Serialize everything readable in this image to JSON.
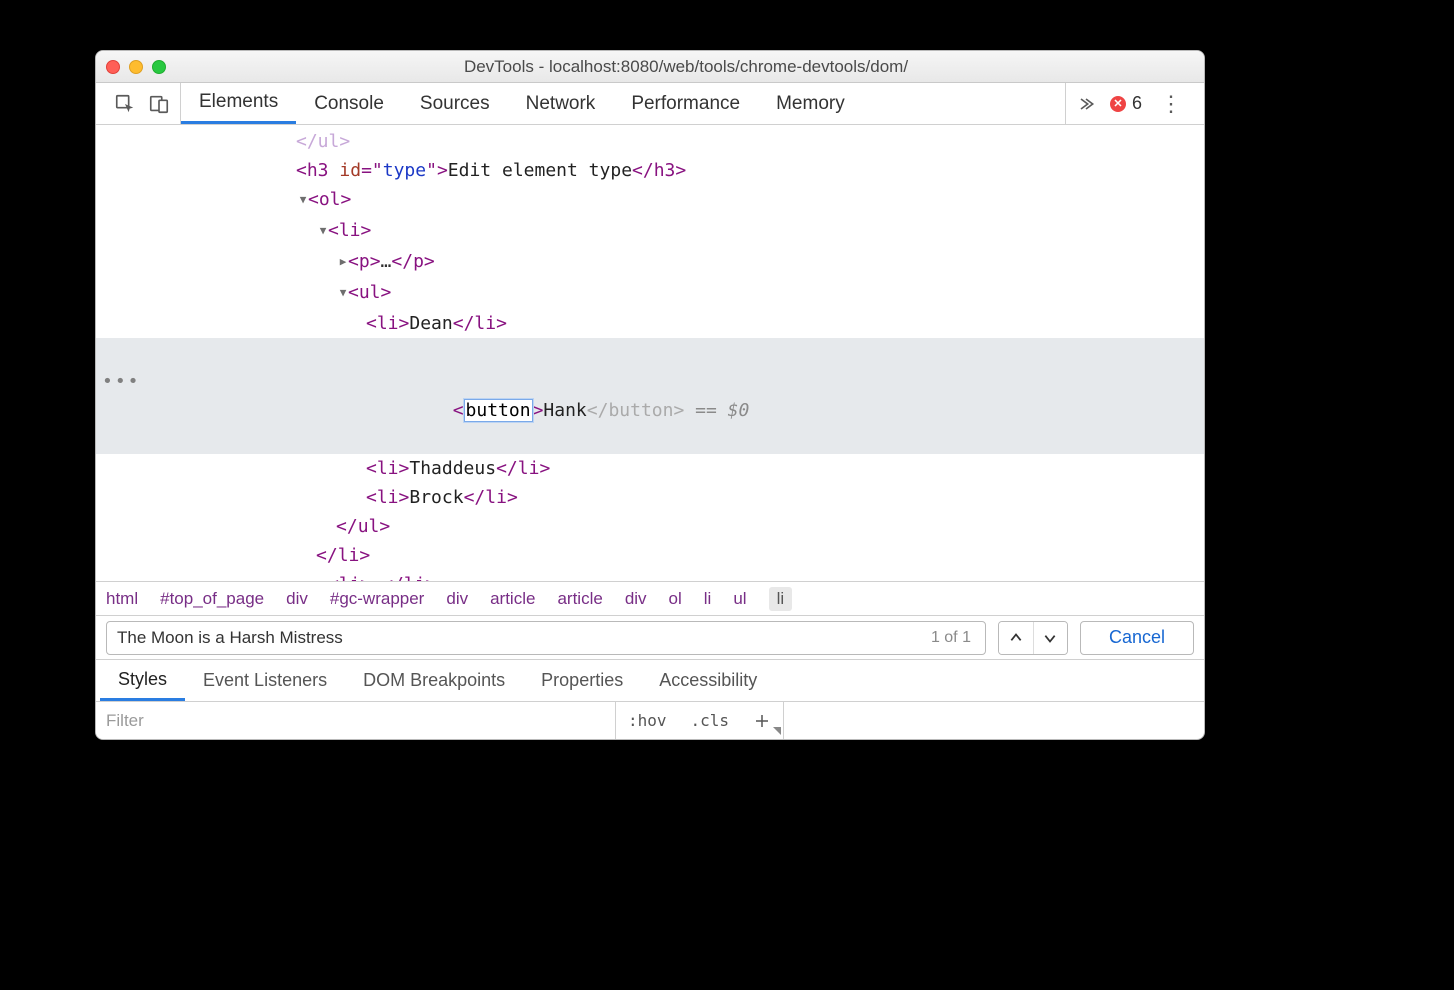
{
  "title": "DevTools - localhost:8080/web/tools/chrome-devtools/dom/",
  "topTabs": [
    "Elements",
    "Console",
    "Sources",
    "Network",
    "Performance",
    "Memory"
  ],
  "activeTopTab": 0,
  "errorCount": "6",
  "dom": {
    "truncated_close": "</ul>",
    "h3_id": "type",
    "h3_text": "Edit element type",
    "items": [
      "Dean",
      "Hank",
      "Thaddeus",
      "Brock"
    ],
    "editing_tag": "button",
    "editing_index": 1,
    "eq_marker": " == $0"
  },
  "breadcrumbs": [
    "html",
    "#top_of_page",
    "div",
    "#gc-wrapper",
    "div",
    "article",
    "article",
    "div",
    "ol",
    "li",
    "ul",
    "li"
  ],
  "search": {
    "value": "The Moon is a Harsh Mistress",
    "counter": "1 of 1",
    "cancel": "Cancel"
  },
  "lowerTabs": [
    "Styles",
    "Event Listeners",
    "DOM Breakpoints",
    "Properties",
    "Accessibility"
  ],
  "activeLowerTab": 0,
  "filter": {
    "placeholder": "Filter",
    "hov": ":hov",
    "cls": ".cls"
  }
}
